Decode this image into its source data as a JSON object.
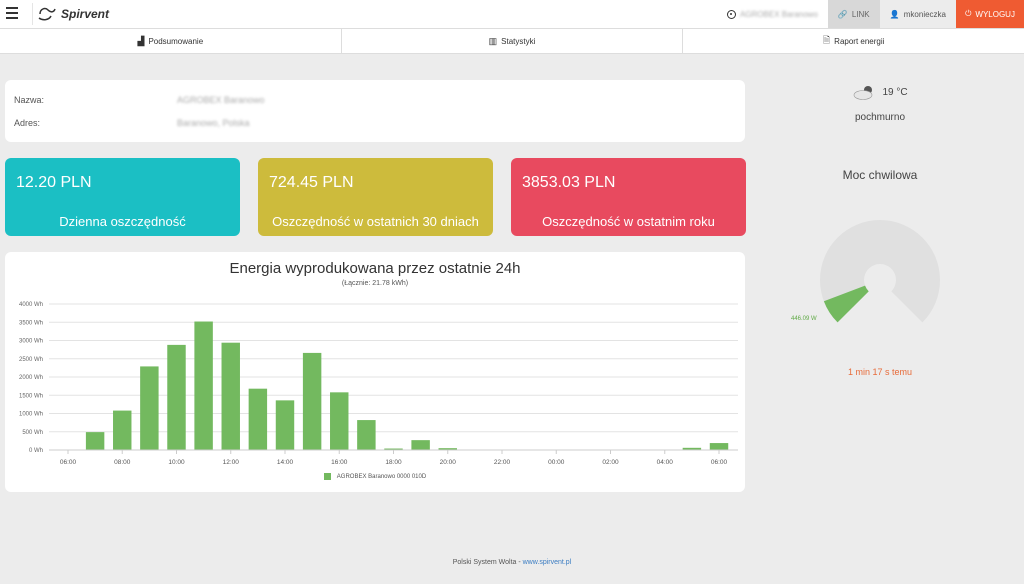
{
  "header": {
    "logo_text": "Spirvent",
    "station_name": "AGROBEX Baranowo",
    "link_label": "LINK",
    "user_label": "mkonieczka",
    "logout_label": "WYLOGUJ"
  },
  "tabs": [
    {
      "label": "Podsumowanie",
      "icon": "area-chart-icon"
    },
    {
      "label": "Statystyki",
      "icon": "bar-chart-icon"
    },
    {
      "label": "Raport energii",
      "icon": "document-icon"
    }
  ],
  "info": {
    "name_label": "Nazwa:",
    "name_value": "AGROBEX Baranowo",
    "address_label": "Adres:",
    "address_value": "Baranowo, Polska"
  },
  "stats": [
    {
      "value": "12.20 PLN",
      "label": "Dzienna oszczędność",
      "color": "#1bbfc4"
    },
    {
      "value": "724.45 PLN",
      "label": "Oszczędność w ostatnich 30 dniach",
      "color": "#cdbb3c"
    },
    {
      "value": "3853.03 PLN",
      "label": "Oszczędność w ostatnim roku",
      "color": "#e84a5f"
    }
  ],
  "chart_data": {
    "type": "bar",
    "title": "Energia wyprodukowana przez ostatnie 24h",
    "subtitle": "(Łącznie: 21.78 kWh)",
    "ylim": [
      0,
      4000
    ],
    "yticks": [
      "0 Wh",
      "500 Wh",
      "1000 Wh",
      "1500 Wh",
      "2000 Wh",
      "2500 Wh",
      "3000 Wh",
      "3500 Wh",
      "4000 Wh"
    ],
    "xticks": [
      "06:00",
      "08:00",
      "10:00",
      "12:00",
      "14:00",
      "16:00",
      "18:00",
      "20:00",
      "22:00",
      "00:00",
      "02:00",
      "04:00",
      "06:00"
    ],
    "categories": [
      "06:00",
      "07:00",
      "08:00",
      "09:00",
      "10:00",
      "11:00",
      "12:00",
      "13:00",
      "14:00",
      "15:00",
      "16:00",
      "17:00",
      "18:00",
      "19:00",
      "20:00",
      "21:00",
      "22:00",
      "23:00",
      "00:00",
      "01:00",
      "02:00",
      "03:00",
      "04:00",
      "05:00",
      "06:00"
    ],
    "series": [
      {
        "name": "AGROBEX Baranowo 0000 010D",
        "color": "#73b95f",
        "values": [
          0,
          490,
          1080,
          2290,
          2880,
          3520,
          2940,
          1680,
          1360,
          2660,
          1580,
          820,
          40,
          270,
          50,
          0,
          0,
          0,
          0,
          0,
          0,
          0,
          0,
          60,
          190
        ]
      }
    ],
    "grid": true,
    "legend": "bottom"
  },
  "weather": {
    "temperature": "19 °C",
    "description": "pochmurno",
    "icon": "cloud-sun-icon"
  },
  "gauge": {
    "title": "Moc chwilowa",
    "value_label": "446.09 W",
    "fraction": 0.09,
    "fill_color": "#73b95f",
    "track_color": "#e0e0e0",
    "updated": "1 min 17 s temu"
  },
  "footer": {
    "text": "Polski System Wolta - ",
    "link": "www.spirvent.pl"
  }
}
